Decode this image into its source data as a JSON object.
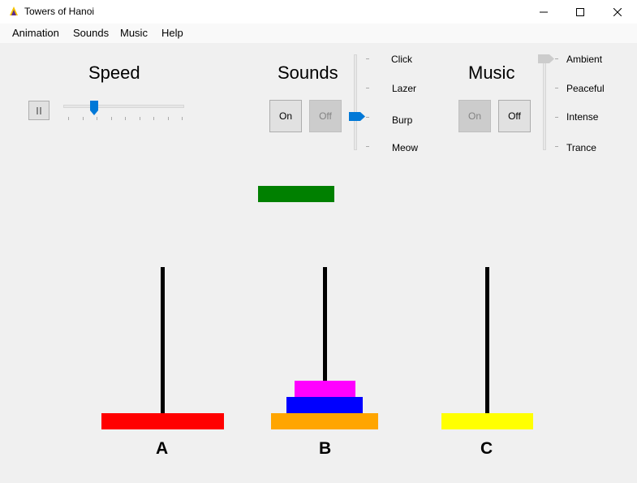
{
  "window": {
    "title": "Towers of Hanoi"
  },
  "menu": [
    "Animation",
    "Sounds",
    "Music",
    "Help"
  ],
  "speed": {
    "title": "Speed",
    "pause_icon": "pause-icon",
    "level": 0.27
  },
  "sounds": {
    "title": "Sounds",
    "on_label": "On",
    "off_label": "Off",
    "on_enabled": true,
    "off_enabled": false,
    "options": [
      "Click",
      "Lazer",
      "Burp",
      "Meow"
    ],
    "selected": "Burp"
  },
  "music": {
    "title": "Music",
    "on_label": "On",
    "off_label": "Off",
    "on_enabled": false,
    "off_enabled": true,
    "options": [
      "Ambient",
      "Peaceful",
      "Intense",
      "Trance"
    ],
    "selected": "Ambient"
  },
  "pegs": [
    {
      "label": "A",
      "disks": [
        {
          "color": "#ff0000",
          "size": 7
        }
      ]
    },
    {
      "label": "B",
      "disks": [
        {
          "color": "#ffa500",
          "size": 6
        },
        {
          "color": "#0000ff",
          "size": 4
        },
        {
          "color": "#ff00ff",
          "size": 3
        }
      ]
    },
    {
      "label": "C",
      "disks": [
        {
          "color": "#ffff00",
          "size": 5
        }
      ]
    }
  ],
  "lifted_disk": {
    "color": "#008000",
    "size": 4
  }
}
